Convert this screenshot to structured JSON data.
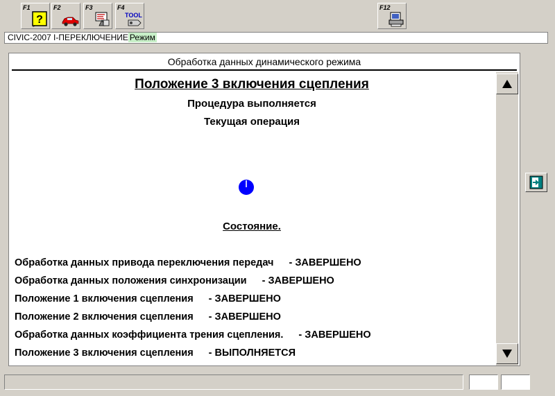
{
  "toolbar": {
    "keys": [
      {
        "label": "F1",
        "icon": "help-icon"
      },
      {
        "label": "F2",
        "icon": "car-icon"
      },
      {
        "label": "F3",
        "icon": "data-icon"
      },
      {
        "label": "F4",
        "icon": "tool-icon"
      },
      {
        "label": "F12",
        "icon": "print-icon"
      }
    ],
    "f4_icon_text": "TOOL"
  },
  "modebar": {
    "model": "CIVIC-2007 I-ПЕРЕКЛЮЧЕНИЕ",
    "mode": "Режим"
  },
  "panel": {
    "title": "Обработка данных динамического режима",
    "heading": "Положение 3 включения сцепления",
    "procedure": "Процедура выполняется",
    "current_op": "Текущая операция",
    "state_label": "Состояние.",
    "rows": [
      {
        "name": "Обработка данных привода переключения передач",
        "status": "-  ЗАВЕРШЕНО"
      },
      {
        "name": "Обработка данных положения синхронизации",
        "status": "-  ЗАВЕРШЕНО"
      },
      {
        "name": "Положение 1 включения сцепления",
        "status": "-  ЗАВЕРШЕНО"
      },
      {
        "name": "Положение 2 включения сцепления",
        "status": "-  ЗАВЕРШЕНО"
      },
      {
        "name": "Обработка данных коэффициента трения сцепления.",
        "status": "-  ЗАВЕРШЕНО"
      },
      {
        "name": "Положение 3 включения сцепления",
        "status": "-  ВЫПОЛНЯЕТСЯ"
      }
    ]
  },
  "colors": {
    "spinner": "#0000ff",
    "mode_bg": "#c8f0c8",
    "exit_icon": "#008080"
  }
}
